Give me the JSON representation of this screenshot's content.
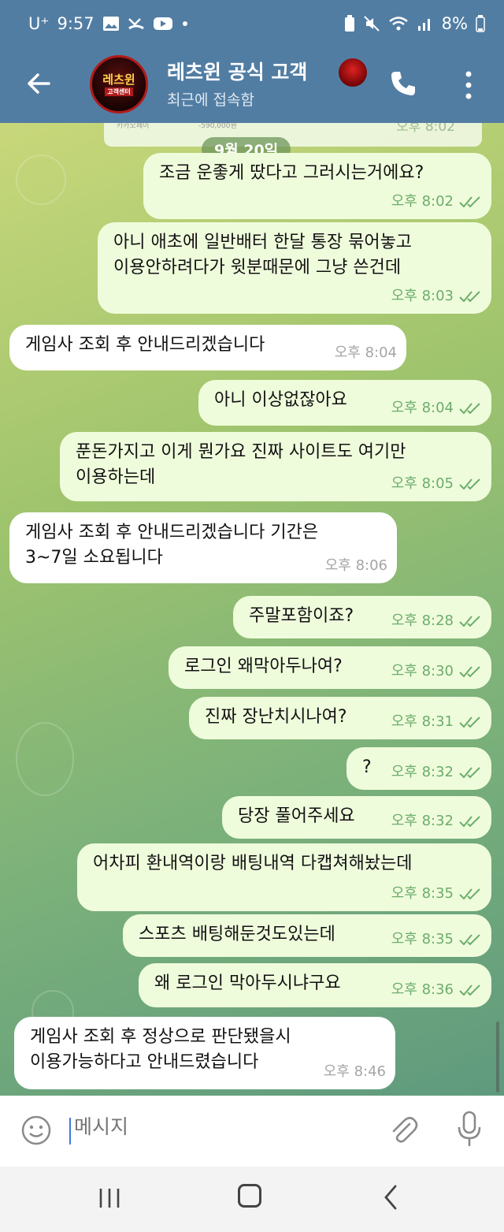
{
  "status_bar": {
    "carrier": "U⁺",
    "time": "9:57",
    "battery": "8%",
    "icons": [
      "gallery-icon",
      "missed-call-icon",
      "youtube-icon",
      "dot-icon",
      "battery-saver-icon",
      "mute-icon",
      "wifi-icon",
      "signal-icon"
    ]
  },
  "header": {
    "title": "레츠윈 공식 고객",
    "subtitle": "최근에 접속함",
    "avatar_text": "레츠윈",
    "avatar_sub": "고객센터"
  },
  "chat": {
    "date": "9월 20일",
    "prev_time": "오후 8:02",
    "prev_cell1": "카카오페이",
    "prev_cell2": "-590,000원",
    "messages": [
      {
        "dir": "out",
        "text": "조금 운좋게 땄다고 그러시는거에요?",
        "time": "오후 8:02"
      },
      {
        "dir": "out",
        "text": "아니 애초에 일반배터 한달 통장 묶어놓고\n이용안하려다가 윗분때문에 그냥 쓴건데",
        "time": "오후 8:03"
      },
      {
        "dir": "in",
        "text": "게임사 조회 후 안내드리겠습니다",
        "time": "오후 8:04"
      },
      {
        "dir": "out",
        "text": "아니 이상없잖아요",
        "time": "오후 8:04"
      },
      {
        "dir": "out",
        "text": "푼돈가지고 이게 뭔가요 진짜 사이트도 여기만\n이용하는데",
        "time": "오후 8:05"
      },
      {
        "dir": "in",
        "text": "게임사 조회 후 안내드리겠습니다 기간은\n3~7일 소요됩니다",
        "time": "오후 8:06"
      },
      {
        "dir": "out",
        "text": "주말포함이죠?",
        "time": "오후 8:28"
      },
      {
        "dir": "out",
        "text": "로그인 왜막아두나여?",
        "time": "오후 8:30"
      },
      {
        "dir": "out",
        "text": "진짜 장난치시나여?",
        "time": "오후 8:31"
      },
      {
        "dir": "out",
        "text": "?",
        "time": "오후 8:32"
      },
      {
        "dir": "out",
        "text": "당장 풀어주세요",
        "time": "오후 8:32"
      },
      {
        "dir": "out",
        "text": "어차피 환내역이랑 배팅내역 다캡쳐해놨는데",
        "time": "오후 8:35"
      },
      {
        "dir": "out",
        "text": "스포츠 배팅해둔것도있는데",
        "time": "오후 8:35"
      },
      {
        "dir": "out",
        "text": "왜 로그인 막아두시냐구요",
        "time": "오후 8:36"
      },
      {
        "dir": "in",
        "text": "게임사 조회 후 정상으로 판단됐을시\n이용가능하다고 안내드렸습니다",
        "time": "오후 8:46"
      }
    ]
  },
  "input": {
    "placeholder": "메시지"
  }
}
